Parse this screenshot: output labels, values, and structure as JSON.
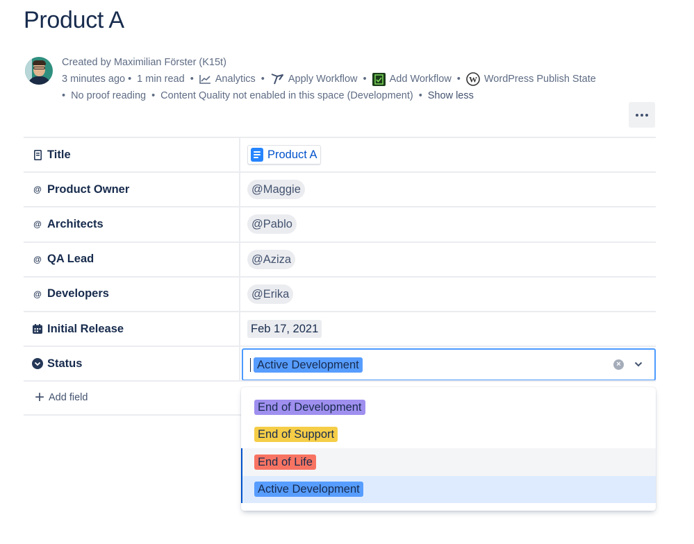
{
  "page": {
    "title": "Product A"
  },
  "byline": {
    "created_by": "Created by Maximilian Förster (K15t)",
    "time_ago": "3 minutes ago",
    "read_time": "1 min read",
    "analytics": "Analytics",
    "apply_workflow": "Apply Workflow",
    "add_workflow": "Add Workflow",
    "wordpress_state": "WordPress Publish State",
    "proof_reading": "No proof reading",
    "content_quality": "Content Quality not enabled in this space (Development)",
    "show_less": "Show less",
    "dot": "•"
  },
  "fields": {
    "title": {
      "label": "Title",
      "value": "Product A"
    },
    "product_owner": {
      "label": "Product Owner",
      "value": "@Maggie"
    },
    "architects": {
      "label": "Architects",
      "value": "@Pablo"
    },
    "qa_lead": {
      "label": "QA Lead",
      "value": "@Aziza"
    },
    "developers": {
      "label": "Developers",
      "value": "@Erika"
    },
    "initial_release": {
      "label": "Initial Release",
      "value": "Feb 17, 2021"
    },
    "status": {
      "label": "Status",
      "value": "Active Development",
      "color": "#579dff"
    },
    "add_field": "Add field",
    "mention_glyph": "@"
  },
  "dropdown": {
    "options": [
      {
        "label": "End of Development",
        "color": "#9f8fef"
      },
      {
        "label": "End of Support",
        "color": "#f5cd47"
      },
      {
        "label": "End of Life",
        "color": "#f87462"
      },
      {
        "label": "Active Development",
        "color": "#579dff"
      }
    ]
  },
  "icons": {
    "analytics": "line-chart-icon",
    "apply_workflow": "workflow-icon",
    "add_workflow": "document-check-icon",
    "wordpress": "wordpress-icon",
    "more": "more-icon"
  }
}
